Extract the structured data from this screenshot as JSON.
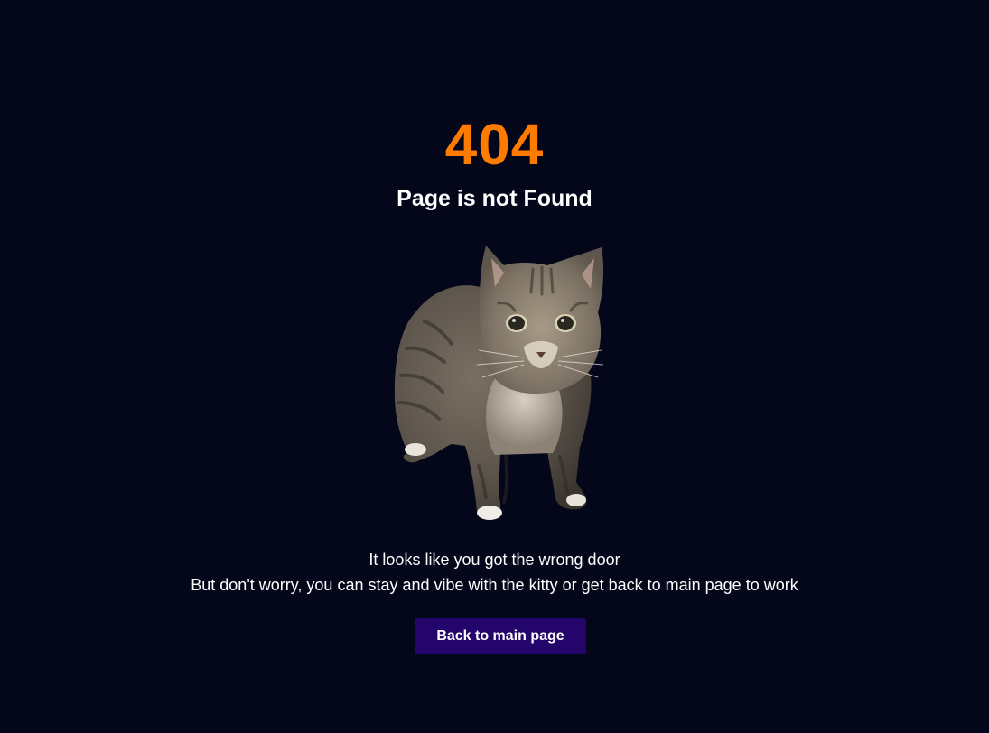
{
  "error": {
    "code": "404",
    "title": "Page is not Found"
  },
  "illustration": {
    "icon": "tabby-cat-image"
  },
  "message": {
    "line1": "It looks like you got the wrong door",
    "line2": "But don't worry, you can stay and vibe with the kitty or get back to main page to work"
  },
  "actions": {
    "back_label": "Back to main page"
  },
  "colors": {
    "background": "#04061a",
    "accent": "#ff7a00",
    "button": "#23056b",
    "text": "#ffffff"
  }
}
